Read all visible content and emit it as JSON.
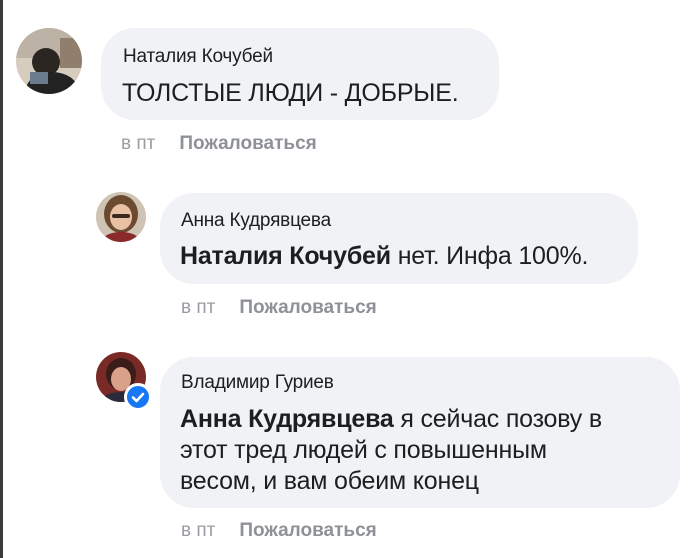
{
  "comments": [
    {
      "author": "Наталия Кочубей",
      "mention": "",
      "text": "ТОЛСТЫЕ ЛЮДИ - ДОБРЫЕ.",
      "time": "в пт",
      "report": "Пожаловаться",
      "avatar_icon": "user-photo-icon",
      "verified": false
    },
    {
      "author": "Анна Кудрявцева",
      "mention": "Наталия Кочубей",
      "text": "нет. Инфа 100%.",
      "time": "в пт",
      "report": "Пожаловаться",
      "avatar_icon": "user-photo-icon",
      "verified": false
    },
    {
      "author": "Владимир Гуриев",
      "mention": "Анна Кудрявцева",
      "text_lines": [
        "я сейчас позову в",
        "этот тред людей с повышенным",
        "весом, и вам обеим конец"
      ],
      "time": "в пт",
      "report": "Пожаловаться",
      "avatar_icon": "user-photo-icon",
      "verified": true
    }
  ],
  "colors": {
    "bubble": "#f0f2f5",
    "text": "#1c1e21",
    "meta": "#8e9196",
    "verified": "#1877f2"
  }
}
